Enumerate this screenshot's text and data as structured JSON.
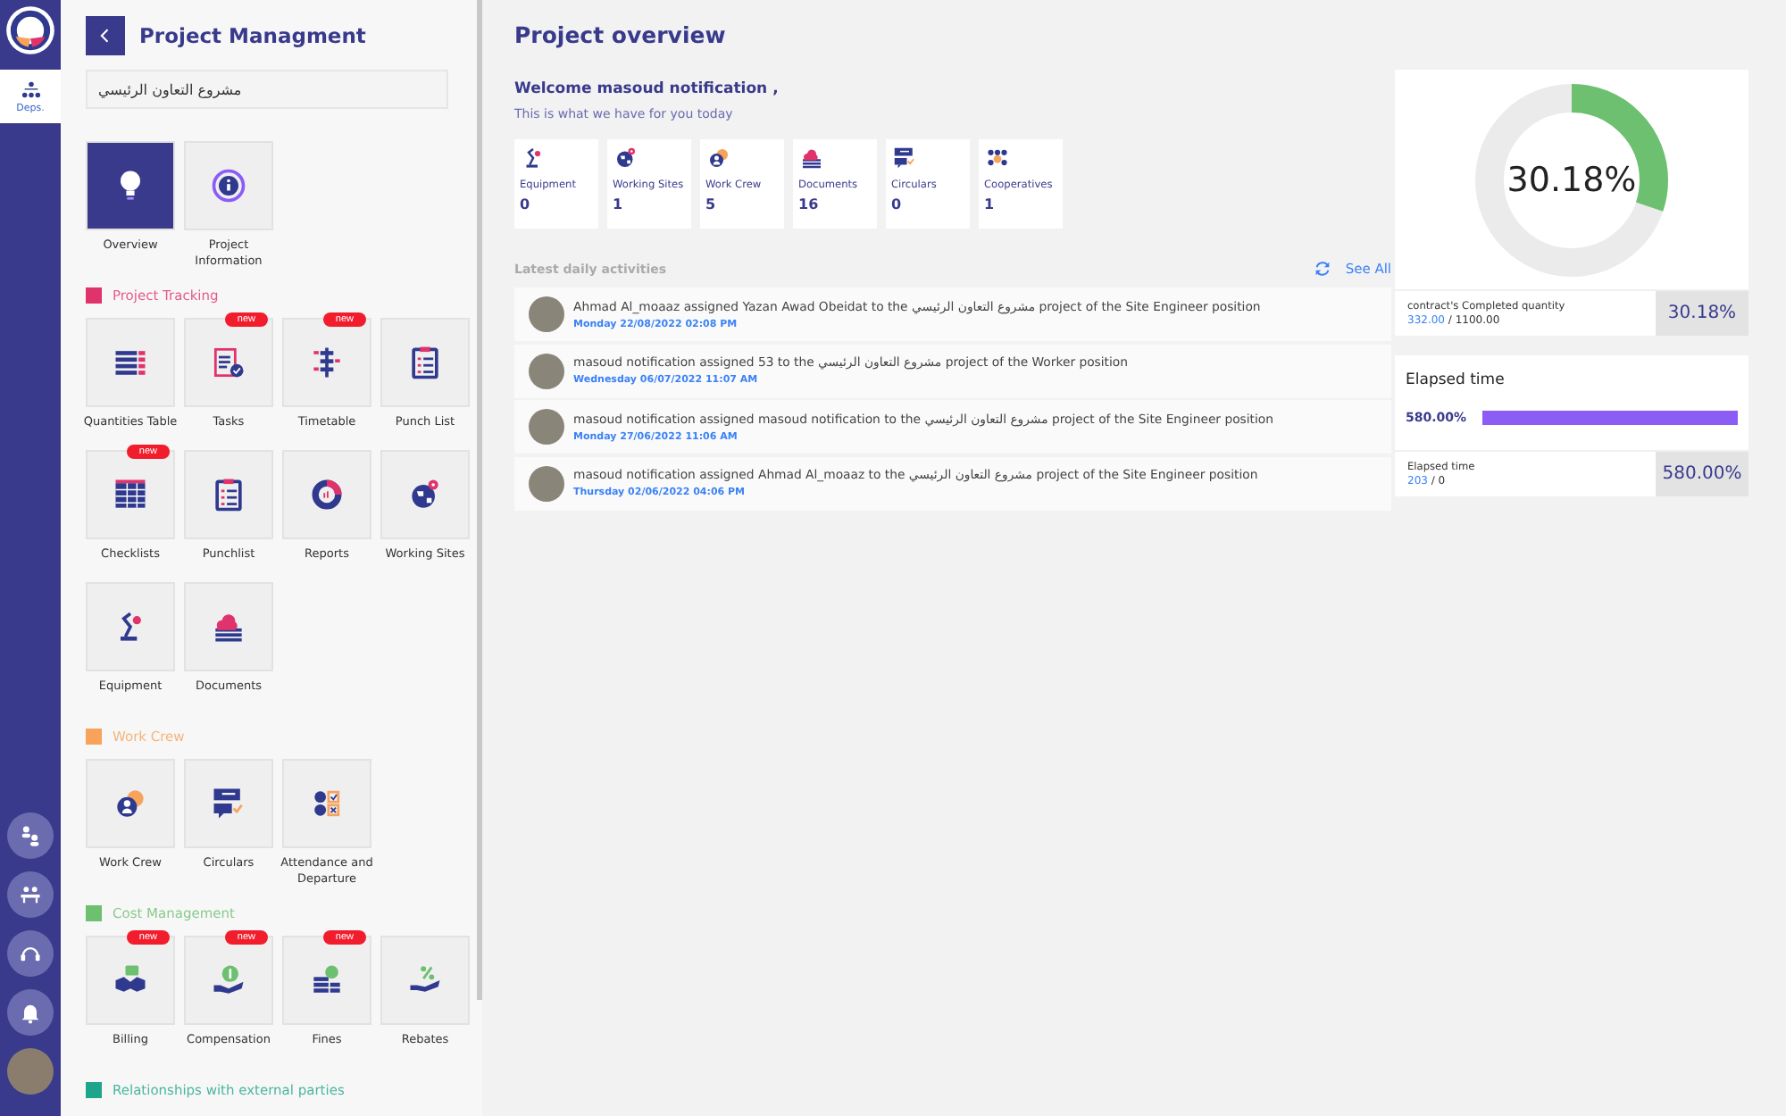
{
  "rail": {
    "items": [
      {
        "label": "Deps.",
        "selected": true
      }
    ]
  },
  "panel": {
    "title": "Project Managment",
    "project_field": {
      "value": "مشروع التعاون الرئيسي"
    },
    "top_tiles": [
      {
        "label": "Overview",
        "kind": "bulb",
        "selected": true
      },
      {
        "label": "Project Information",
        "kind": "info",
        "selected": false
      }
    ],
    "sections": [
      {
        "title": "Project Tracking",
        "color": "#e0336c",
        "tiles": [
          {
            "label": "Quantities Table",
            "kind": "table"
          },
          {
            "label": "Tasks",
            "kind": "tasks",
            "badge": "new"
          },
          {
            "label": "Timetable",
            "kind": "timetable",
            "badge": "new"
          },
          {
            "label": "Punch List",
            "kind": "punch"
          },
          {
            "label": "Checklists",
            "kind": "checklist",
            "badge": "new"
          },
          {
            "label": "Punchlist",
            "kind": "punch"
          },
          {
            "label": "Reports",
            "kind": "reports"
          },
          {
            "label": "Working Sites",
            "kind": "globe"
          },
          {
            "label": "Equipment",
            "kind": "equipment"
          },
          {
            "label": "Documents",
            "kind": "documents"
          }
        ]
      },
      {
        "title": "Work Crew",
        "color": "#f7a35c",
        "tiles": [
          {
            "label": "Work Crew",
            "kind": "crew"
          },
          {
            "label": "Circulars",
            "kind": "circulars"
          },
          {
            "label": "Attendance and Departure",
            "kind": "attendance"
          }
        ]
      },
      {
        "title": "Cost Management",
        "color": "#6cc070",
        "tiles": [
          {
            "label": "Billing",
            "kind": "billing",
            "badge": "new"
          },
          {
            "label": "Compensation",
            "kind": "compensation",
            "badge": "new"
          },
          {
            "label": "Fines",
            "kind": "fines",
            "badge": "new"
          },
          {
            "label": "Rebates",
            "kind": "rebates"
          }
        ]
      },
      {
        "title": "Relationships with external parties",
        "color": "#1fa58a"
      }
    ]
  },
  "main": {
    "title": "Project overview",
    "welcome": "Welcome masoud notification ,",
    "subtitle": "This is what we have for you today",
    "stats": [
      {
        "label": "Equipment",
        "value": "0",
        "kind": "equipment"
      },
      {
        "label": "Working Sites",
        "value": "1",
        "kind": "globe"
      },
      {
        "label": "Work Crew",
        "value": "5",
        "kind": "crew"
      },
      {
        "label": "Documents",
        "value": "16",
        "kind": "documents"
      },
      {
        "label": "Circulars",
        "value": "0",
        "kind": "circulars"
      },
      {
        "label": "Cooperatives",
        "value": "1",
        "kind": "cooperatives"
      }
    ],
    "activities": {
      "title": "Latest daily activities",
      "see_all": "See All",
      "items": [
        {
          "text": "Ahmad Al_moaaz assigned Yazan Awad Obeidat to the مشروع التعاون الرئيسي project of the Site Engineer position",
          "time": "Monday 22/08/2022 02:08 PM"
        },
        {
          "text": "masoud notification assigned 53 to the مشروع التعاون الرئيسي project of the Worker position",
          "time": "Wednesday 06/07/2022 11:07 AM"
        },
        {
          "text": "masoud notification assigned masoud notification to the مشروع التعاون الرئيسي project of the Site Engineer position",
          "time": "Monday 27/06/2022 11:06 AM"
        },
        {
          "text": "masoud notification assigned Ahmad Al_moaaz to the مشروع التعاون الرئيسي project of the Site Engineer position",
          "time": "Thursday 02/06/2022 04:06 PM"
        }
      ]
    }
  },
  "side": {
    "completion": {
      "level": 0.3018,
      "reading": "30.18%",
      "label": "contract's Completed quantity",
      "done": "332.00",
      "total": "/ 1100.00",
      "value": "30.18%"
    },
    "elapsed": {
      "title": "Elapsed time",
      "reading": "580.00%",
      "level": 1,
      "label": "Elapsed time",
      "done": "203",
      "total": "/ 0",
      "value": "580.00%"
    }
  }
}
